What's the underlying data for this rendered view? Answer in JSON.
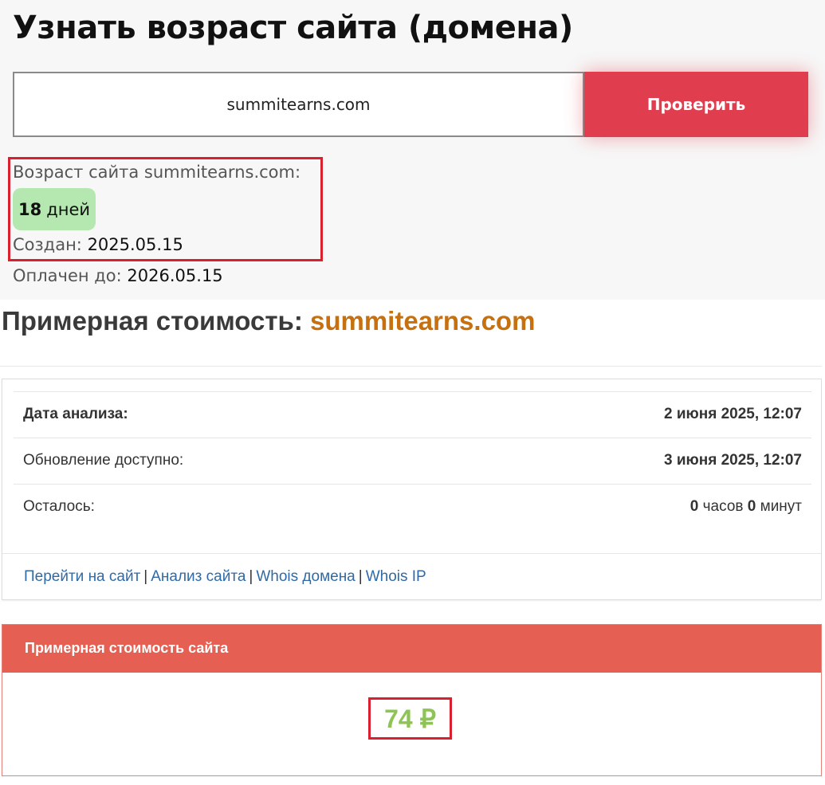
{
  "page": {
    "title": "Узнать возраст сайта (домена)"
  },
  "search": {
    "value": "summitearns.com",
    "button_label": "Проверить"
  },
  "result": {
    "age_label": "Возраст сайта summitearns.com:",
    "age_value": "18",
    "age_unit": "дней",
    "created_label": "Создан:",
    "created_value": "2025.05.15",
    "paid_label": "Оплачен до:",
    "paid_value": "2026.05.15"
  },
  "estimate": {
    "title_prefix": "Примерная стоимость:",
    "domain": "summitearns.com"
  },
  "info": {
    "rows": [
      {
        "key": "Дата анализа:",
        "value": "2 июня 2025, 12:07"
      },
      {
        "key": "Обновление доступно:",
        "value": "3 июня 2025, 12:07"
      },
      {
        "key": "Осталось:",
        "hours": "0",
        "hours_unit": "часов",
        "minutes": "0",
        "minutes_unit": "минут"
      }
    ],
    "links": [
      "Перейти на сайт",
      "Анализ сайта",
      "Whois домена",
      "Whois IP"
    ],
    "separator": "|"
  },
  "price": {
    "header": "Примерная стоимость сайта",
    "value": "74 ₽"
  },
  "colors": {
    "accent_button": "#e03d4e",
    "badge": "#b5e8b0",
    "domain_orange": "#c6700f",
    "price_header": "#e56053",
    "price_green": "#8dc455",
    "highlight_border": "#d8202e",
    "link_blue": "#2f6aa7"
  }
}
